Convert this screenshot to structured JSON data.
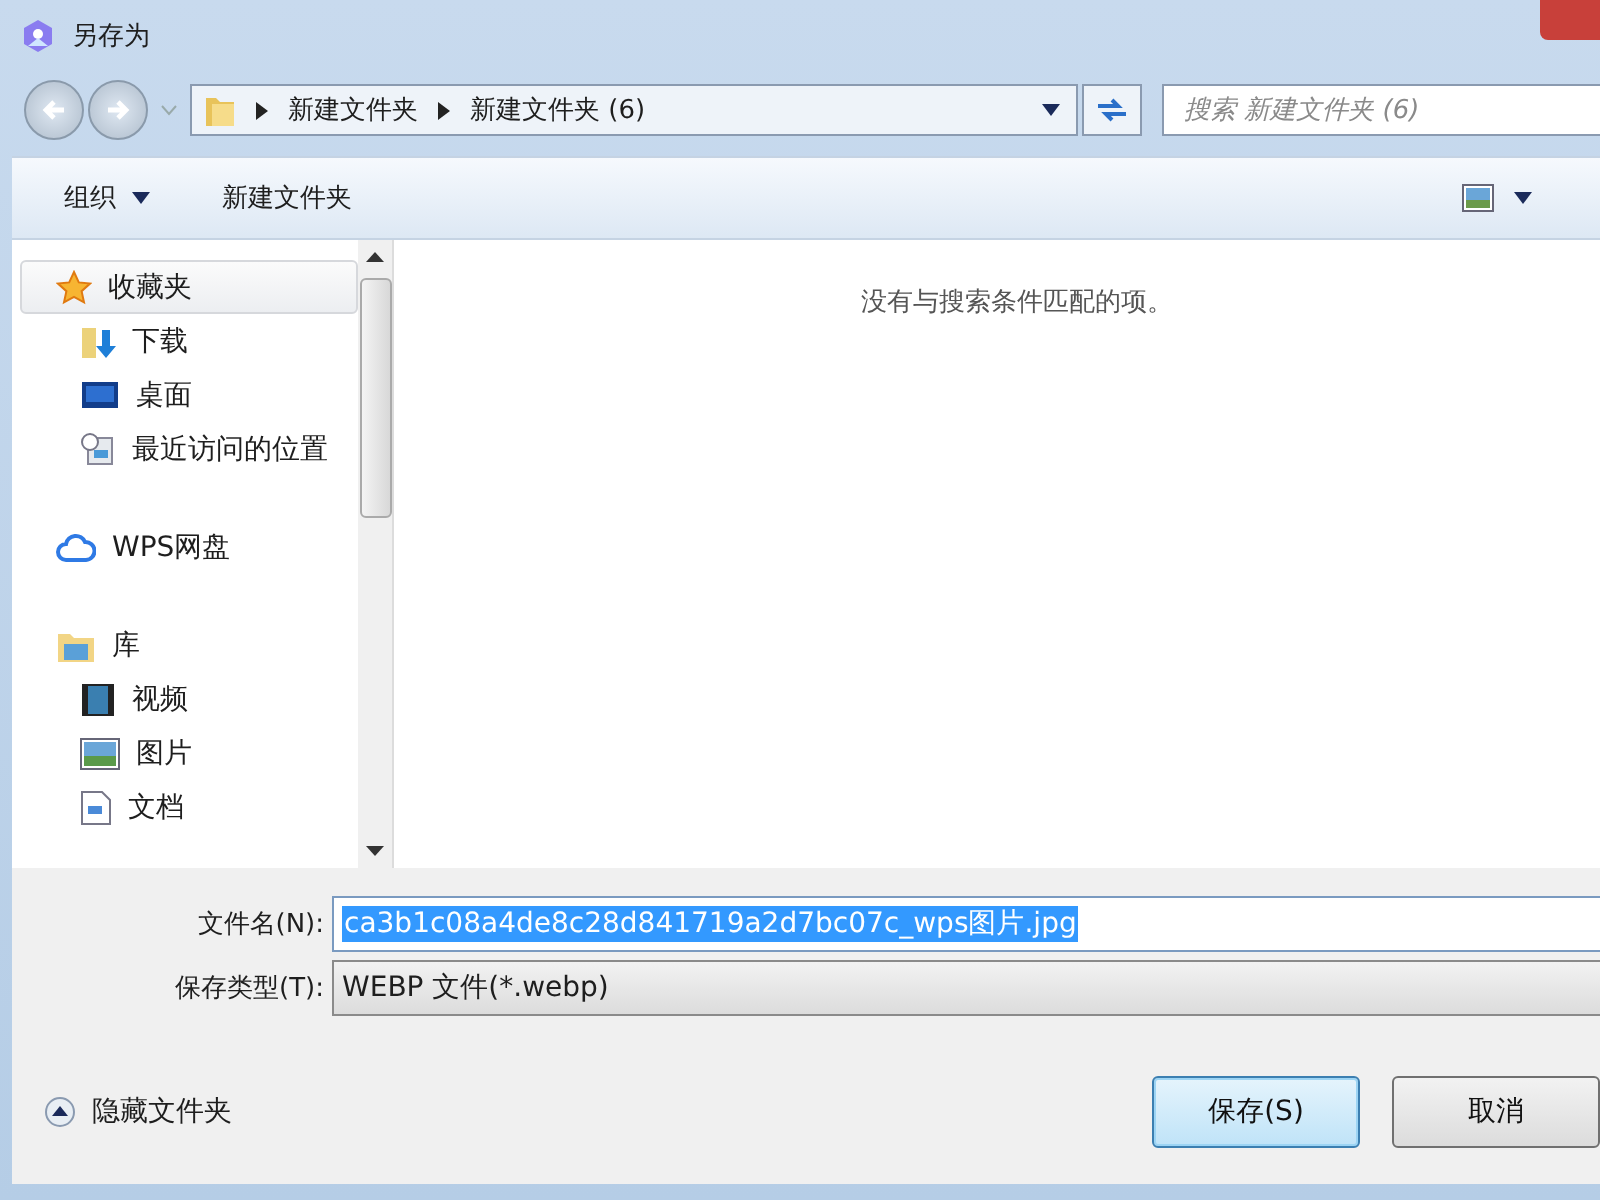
{
  "window": {
    "title": "另存为"
  },
  "address_bar": {
    "path": [
      {
        "label": "新建文件夹"
      },
      {
        "label": "新建文件夹 (6)"
      }
    ]
  },
  "search": {
    "placeholder": "搜索 新建文件夹 (6)"
  },
  "toolbar": {
    "organize": "组织",
    "new_folder": "新建文件夹"
  },
  "sidebar": {
    "items": [
      {
        "label": "收藏夹",
        "selected": true,
        "children": [
          {
            "label": "下载",
            "selected": false
          },
          {
            "label": "桌面",
            "selected": false
          },
          {
            "label": "最近访问的位置",
            "selected": false
          }
        ]
      },
      {
        "label": "WPS网盘",
        "selected": false
      },
      {
        "label": "库",
        "selected": false,
        "children": [
          {
            "label": "视频",
            "selected": false
          },
          {
            "label": "图片",
            "selected": false
          },
          {
            "label": "文档",
            "selected": false
          }
        ]
      }
    ]
  },
  "content": {
    "empty_message": "没有与搜索条件匹配的项。"
  },
  "file_name": {
    "label": "文件名(N):",
    "value": "ca3b1c08a4de8c28d841719a2d7bc07c_wps图片.jpg"
  },
  "save_type": {
    "label": "保存类型(T):",
    "value": "WEBP 文件(*.webp)"
  },
  "hide_folders": "隐藏文件夹",
  "buttons": [
    {
      "label": "保存(S)",
      "kind": "primary"
    },
    {
      "label": "取消",
      "kind": "normal"
    }
  ]
}
